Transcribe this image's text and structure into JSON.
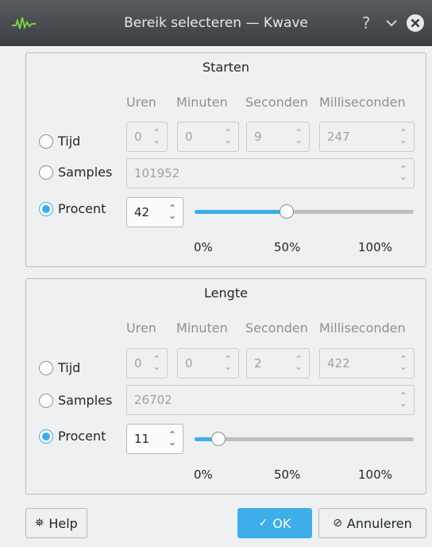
{
  "window": {
    "title": "Bereik selecteren — Kwave",
    "icons": {
      "app": "kwave-waveform-icon",
      "help": "question-mark-icon",
      "minimize": "chevron-down-icon",
      "close": "close-circle-icon"
    }
  },
  "columns": [
    "Uren",
    "Minuten",
    "Seconden",
    "Milliseconden"
  ],
  "start": {
    "title": "Starten",
    "mode": "Procent",
    "time_label": "Tijd",
    "samples_label": "Samples",
    "percent_label": "Procent",
    "time": {
      "hours": "0",
      "minutes": "0",
      "seconds": "9",
      "milliseconds": "247"
    },
    "samples": "101952",
    "percent": "42",
    "slider_value": 42,
    "ticks": [
      "0%",
      "50%",
      "100%"
    ]
  },
  "length": {
    "title": "Lengte",
    "mode": "Procent",
    "time_label": "Tijd",
    "samples_label": "Samples",
    "percent_label": "Procent",
    "time": {
      "hours": "0",
      "minutes": "0",
      "seconds": "2",
      "milliseconds": "422"
    },
    "samples": "26702",
    "percent": "11",
    "slider_value": 11,
    "ticks": [
      "0%",
      "50%",
      "100%"
    ]
  },
  "buttons": {
    "help": "Help",
    "ok": "OK",
    "cancel": "Annuleren"
  },
  "colors": {
    "accent": "#3daee9",
    "titlebar": "#474b50",
    "background": "#eff0f1"
  }
}
